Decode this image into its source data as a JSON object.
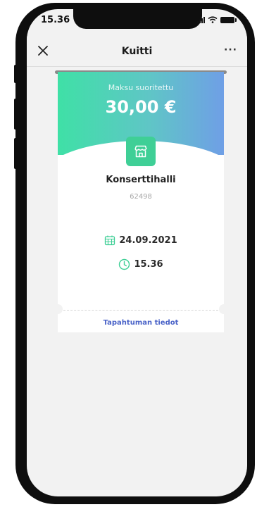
{
  "status_bar": {
    "time": "15.36"
  },
  "navbar": {
    "title": "Kuitti",
    "more": "···"
  },
  "receipt": {
    "status": "Maksu suoritettu",
    "amount": "30,00 €",
    "merchant_name": "Konserttihalli",
    "merchant_id": "62498",
    "date": "24.09.2021",
    "time": "15.36",
    "details_link": "Tapahtuman tiedot"
  },
  "colors": {
    "gradient_start": "#3fe0a6",
    "gradient_end": "#6f9fe6",
    "accent_green": "#3fcf96",
    "link_blue": "#4a63c8"
  },
  "icons": {
    "close": "close-icon",
    "more": "more-icon",
    "store": "store-icon",
    "calendar": "calendar-icon",
    "clock": "clock-icon"
  }
}
